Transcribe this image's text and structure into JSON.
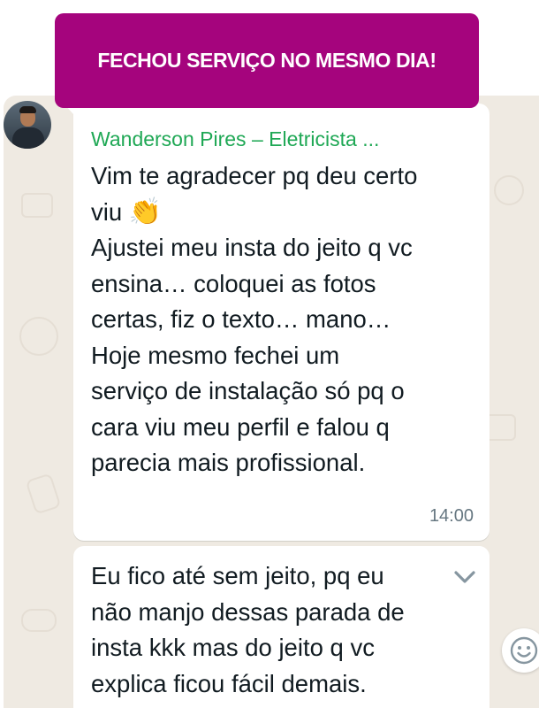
{
  "banner": {
    "text": "FECHOU SERVIÇO NO MESMO DIA!",
    "color": "#a5047d"
  },
  "messages": [
    {
      "sender": "Wanderson Pires – Eletricista ...",
      "lines": [
        "Vim te agradecer pq deu certo",
        "viu",
        "Ajustei meu insta do jeito q vc",
        "ensina… coloquei as fotos",
        "certas, fiz o texto… mano…",
        "Hoje mesmo fechei um",
        "serviço de instalação só pq o",
        "cara viu meu perfil e falou q",
        "parecia mais profissional."
      ],
      "emoji": "👏",
      "time": "14:00"
    },
    {
      "lines": [
        "Eu fico até sem jeito, pq eu",
        "não manjo dessas parada de",
        "insta kkk mas do jeito q vc",
        "explica ficou fácil demais."
      ]
    }
  ],
  "icons": {
    "menu_chevron": "chevron-down-icon",
    "reaction": "emoji-smile-icon"
  },
  "colors": {
    "sender_name": "#1fa855",
    "chat_background": "#efeae2",
    "bubble": "#ffffff",
    "timestamp": "#667781"
  }
}
